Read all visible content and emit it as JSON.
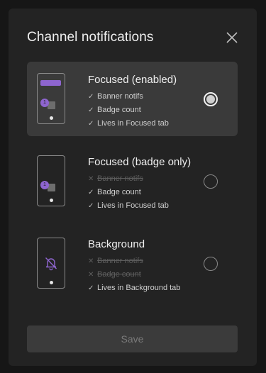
{
  "dialog": {
    "title": "Channel notifications",
    "close_icon": "close-icon"
  },
  "options": [
    {
      "title": "Focused (enabled)",
      "selected": true,
      "phone_badge": "1",
      "features": [
        {
          "label": "Banner notifs",
          "enabled": true
        },
        {
          "label": "Badge count",
          "enabled": true
        },
        {
          "label": "Lives in Focused tab",
          "enabled": true
        }
      ]
    },
    {
      "title": "Focused (badge only)",
      "selected": false,
      "phone_badge": "1",
      "features": [
        {
          "label": "Banner notifs",
          "enabled": false
        },
        {
          "label": "Badge count",
          "enabled": true
        },
        {
          "label": "Lives in Focused tab",
          "enabled": true
        }
      ]
    },
    {
      "title": "Background",
      "selected": false,
      "phone_icon": "bell-off-icon",
      "features": [
        {
          "label": "Banner notifs",
          "enabled": false
        },
        {
          "label": "Badge count",
          "enabled": false
        },
        {
          "label": "Lives in Background tab",
          "enabled": true
        }
      ]
    }
  ],
  "footer": {
    "save_label": "Save",
    "save_disabled": true
  },
  "colors": {
    "accent": "#8e65cf",
    "modal_bg": "#232323",
    "selected_bg": "#3a3a3a"
  }
}
